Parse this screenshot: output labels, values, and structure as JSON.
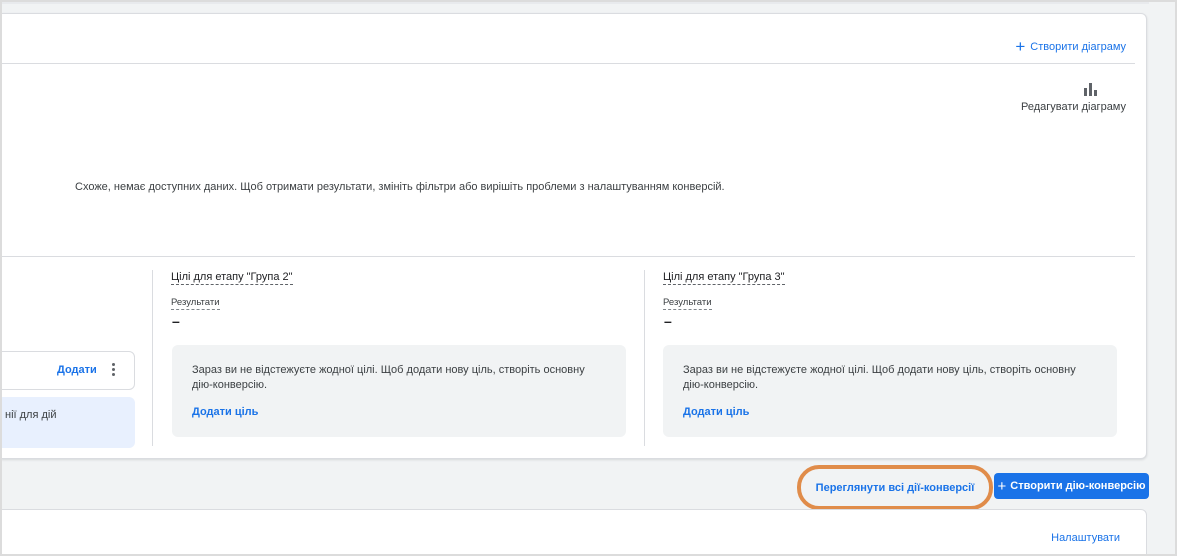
{
  "header": {
    "create_chart_label": "Створити діаграму",
    "edit_chart_label": "Редагувати діаграму"
  },
  "chart_area": {
    "empty_message": "Схоже, немає доступних даних. Щоб отримати результати, змініть фільтри або вирішіть проблеми з налаштуванням конверсій."
  },
  "left_column": {
    "add_label": "Додати",
    "info_text_partial": "нії для дій"
  },
  "stages": [
    {
      "title": "Цілі для етапу \"Група 2\"",
      "results_label": "Результати",
      "results_value": "–",
      "message": "Зараз ви не відстежуєте жодної цілі. Щоб додати нову ціль, створіть основну дію-конверсію.",
      "add_goal_label": "Додати ціль"
    },
    {
      "title": "Цілі для етапу \"Група 3\"",
      "results_label": "Результати",
      "results_value": "–",
      "message": "Зараз ви не відстежуєте жодної цілі. Щоб додати нову ціль, створіть основну дію-конверсію.",
      "add_goal_label": "Додати ціль"
    }
  ],
  "actions": {
    "view_all_label": "Переглянути всі дії-конверсії",
    "create_conversion_label": "Створити дію-конверсію"
  },
  "bottom_card": {
    "settings_label": "Налаштувати"
  },
  "colors": {
    "accent": "#1a73e8",
    "highlight": "#e08c4a",
    "panel_bg": "#f1f3f4",
    "selected_bg": "#e8f0fe"
  }
}
